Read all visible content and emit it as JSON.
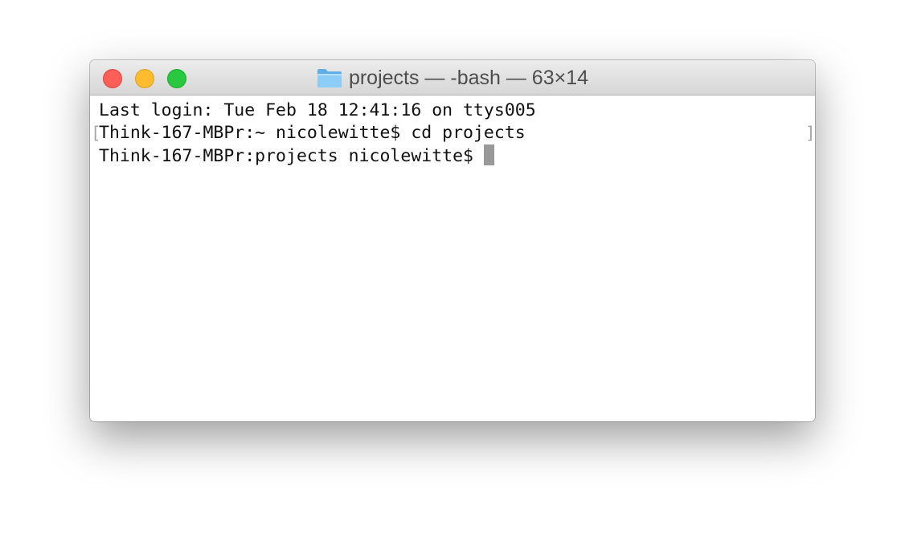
{
  "window": {
    "title": "projects — -bash — 63×14",
    "title_icon": "folder-icon",
    "controls": [
      "close",
      "minimize",
      "zoom"
    ]
  },
  "terminal": {
    "lines": [
      "Last login: Tue Feb 18 12:41:16 on ttys005",
      "Think-167-MBPr:~ nicolewitte$ cd projects",
      "Think-167-MBPr:projects nicolewitte$"
    ],
    "mark_left": "[",
    "mark_right": "]"
  },
  "colors": {
    "close": "#fe5f57",
    "minimize": "#febc2e",
    "zoom": "#28c840",
    "folder": "#7fc4f4",
    "cursor": "#999999",
    "text": "#111111"
  }
}
